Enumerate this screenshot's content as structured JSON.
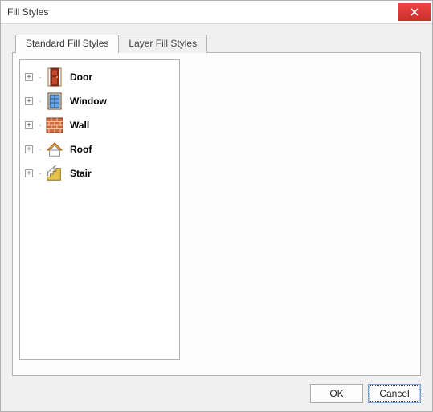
{
  "window": {
    "title": "Fill Styles"
  },
  "tabs": {
    "active": "Standard Fill Styles",
    "inactive": "Layer Fill Styles"
  },
  "tree_items": [
    {
      "label": "Door",
      "icon": "door-icon"
    },
    {
      "label": "Window",
      "icon": "window-icon"
    },
    {
      "label": "Wall",
      "icon": "wall-icon"
    },
    {
      "label": "Roof",
      "icon": "roof-icon"
    },
    {
      "label": "Stair",
      "icon": "stair-icon"
    }
  ],
  "buttons": {
    "ok": "OK",
    "cancel": "Cancel"
  }
}
